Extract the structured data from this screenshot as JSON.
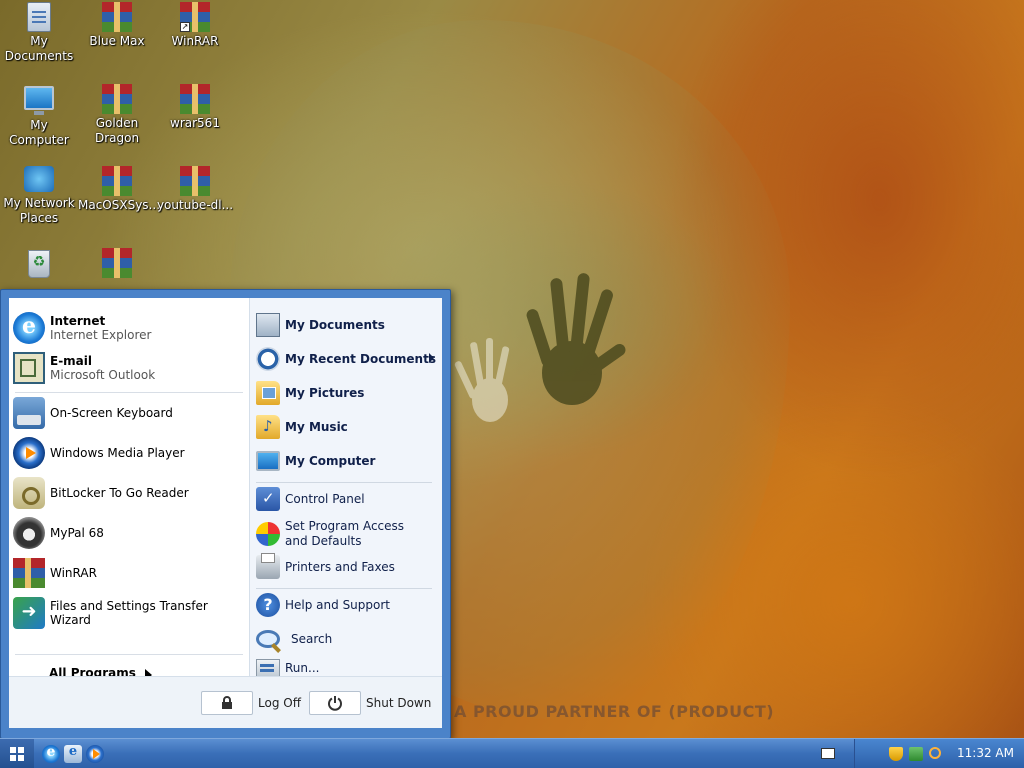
{
  "desktop": {
    "icons": [
      {
        "label": "My Documents",
        "icon": "my-documents-icon"
      },
      {
        "label": "Blue Max",
        "icon": "winrar-archive-icon"
      },
      {
        "label": "WinRAR",
        "icon": "winrar-shortcut-icon"
      },
      {
        "label": "My Computer",
        "icon": "my-computer-icon"
      },
      {
        "label": "Golden Dragon",
        "icon": "winrar-archive-icon"
      },
      {
        "label": "wrar561",
        "icon": "winrar-archive-icon"
      },
      {
        "label": "My Network Places",
        "icon": "network-places-icon"
      },
      {
        "label": "MacOSXSys...",
        "icon": "winrar-archive-icon"
      },
      {
        "label": "youtube-dl...",
        "icon": "winrar-archive-icon"
      },
      {
        "label": "",
        "icon": "recycle-bin-icon"
      },
      {
        "label": "",
        "icon": "winrar-archive-icon"
      }
    ],
    "wallpaper_text": "A PROUD PARTNER OF (PRODUCT)"
  },
  "start_menu": {
    "pinned": [
      {
        "title": "Internet",
        "subtitle": "Internet Explorer",
        "icon": "internet-explorer-icon"
      },
      {
        "title": "E-mail",
        "subtitle": "Microsoft Outlook",
        "icon": "outlook-icon"
      }
    ],
    "recent": [
      {
        "label": "On-Screen Keyboard",
        "icon": "keyboard-icon"
      },
      {
        "label": "Windows Media Player",
        "icon": "media-player-icon"
      },
      {
        "label": "BitLocker To Go Reader",
        "icon": "bitlocker-icon"
      },
      {
        "label": "MyPal 68",
        "icon": "mypal-icon"
      },
      {
        "label": "WinRAR",
        "icon": "winrar-icon"
      },
      {
        "label": "Files and Settings Transfer Wizard",
        "icon": "transfer-wizard-icon"
      }
    ],
    "all_programs": "All Programs",
    "places": [
      {
        "label": "My Documents",
        "icon": "documents-icon"
      },
      {
        "label": "My Recent Documents",
        "icon": "recent-documents-icon",
        "submenu": true
      },
      {
        "label": "My Pictures",
        "icon": "pictures-folder-icon"
      },
      {
        "label": "My Music",
        "icon": "music-folder-icon"
      },
      {
        "label": "My Computer",
        "icon": "computer-icon"
      }
    ],
    "system": [
      {
        "label": "Control Panel",
        "icon": "control-panel-icon"
      },
      {
        "label": "Set Program Access and Defaults",
        "icon": "program-defaults-icon"
      },
      {
        "label": "Printers and Faxes",
        "icon": "printer-icon"
      }
    ],
    "support": [
      {
        "label": "Help and Support",
        "icon": "help-icon"
      },
      {
        "label": "Search",
        "icon": "search-icon"
      },
      {
        "label": "Run...",
        "icon": "run-icon"
      }
    ],
    "log_off": "Log Off",
    "shut_down": "Shut Down"
  },
  "taskbar": {
    "clock": "11:32 AM"
  }
}
